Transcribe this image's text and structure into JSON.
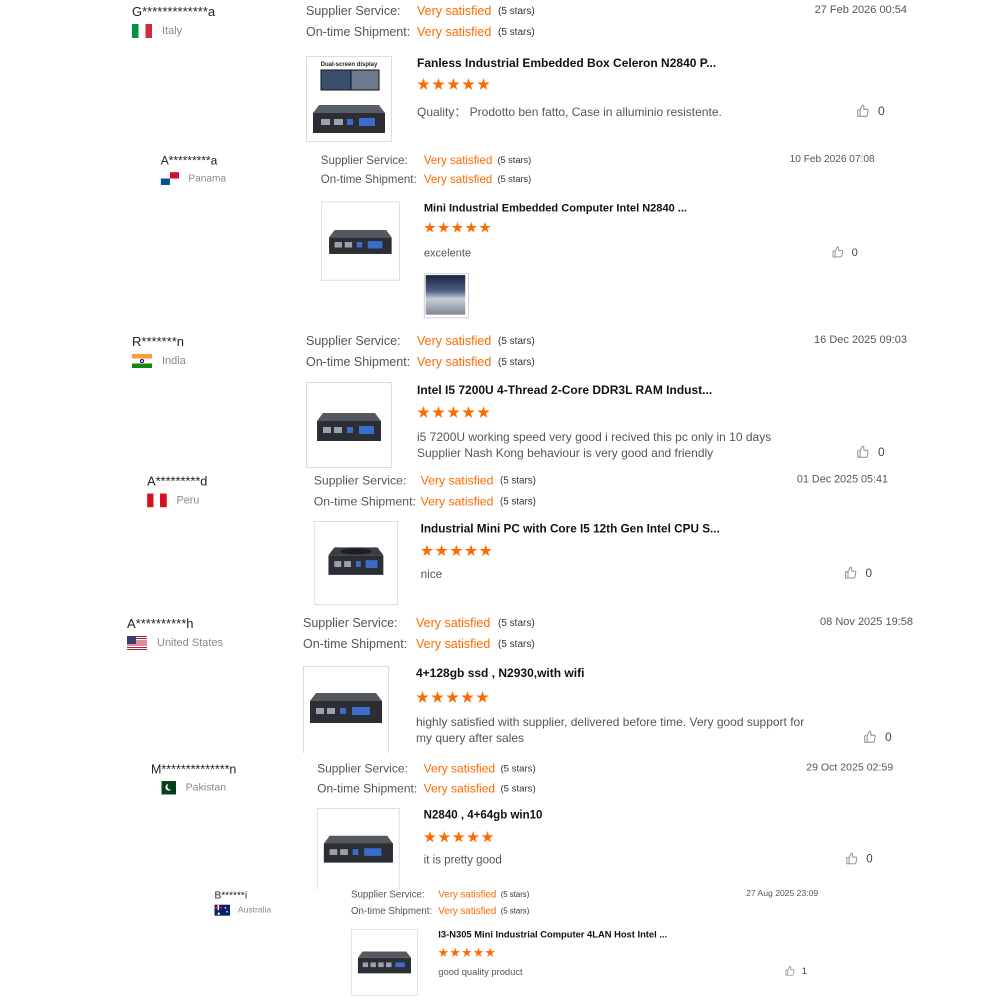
{
  "labels": {
    "supplier_service": "Supplier Service:",
    "shipment": "On-time Shipment:"
  },
  "reviews": [
    {
      "buyer": "G*************a",
      "country": "Italy",
      "supplier_value": "Very satisfied",
      "supplier_stars": "(5 stars)",
      "shipment_value": "Very satisfied",
      "shipment_stars": "(5 stars)",
      "date": "27 Feb 2026 00:54",
      "product_title": "Fanless Industrial Embedded Box Celeron N2840 P...",
      "thumbnail_caption": "Dual-screen display",
      "rating": 5,
      "comment": "Quality：  Prodotto ben fatto, Case in alluminio resistente.",
      "likes": "0"
    },
    {
      "buyer": "A*********a",
      "country": "Panama",
      "supplier_value": "Very satisfied",
      "supplier_stars": "(5 stars)",
      "shipment_value": "Very satisfied",
      "shipment_stars": "(5 stars)",
      "date": "10 Feb 2026 07:08",
      "product_title": "Mini Industrial Embedded Computer Intel N2840 ...",
      "rating": 5,
      "comment": "excelente",
      "likes": "0"
    },
    {
      "buyer": "R*******n",
      "country": "India",
      "supplier_value": "Very satisfied",
      "supplier_stars": "(5 stars)",
      "shipment_value": "Very satisfied",
      "shipment_stars": "(5 stars)",
      "date": "16 Dec 2025 09:03",
      "product_title": "Intel I5 7200U 4-Thread 2-Core DDR3L RAM Indust...",
      "rating": 5,
      "comment": "i5 7200U working speed very good i recived this pc only in 10 days Supplier Nash Kong behaviour is very good and friendly",
      "likes": "0"
    },
    {
      "buyer": "A*********d",
      "country": "Peru",
      "supplier_value": "Very satisfied",
      "supplier_stars": "(5 stars)",
      "shipment_value": "Very satisfied",
      "shipment_stars": "(5 stars)",
      "date": "01 Dec 2025 05:41",
      "product_title": "Industrial Mini PC with Core I5 12th Gen Intel CPU S...",
      "rating": 5,
      "comment": "nice",
      "likes": "0"
    },
    {
      "buyer": "A**********h",
      "country": "United States",
      "supplier_value": "Very satisfied",
      "supplier_stars": "(5 stars)",
      "shipment_value": "Very satisfied",
      "shipment_stars": "(5 stars)",
      "date": "08 Nov 2025 19:58",
      "product_title": "4+128gb ssd , N2930,with wifi",
      "rating": 5,
      "comment": "highly satisfied with supplier, delivered before time.  Very good support for my query after sales",
      "likes": "0"
    },
    {
      "buyer": "M**************n",
      "country": "Pakistan",
      "supplier_value": "Very satisfied",
      "supplier_stars": "(5 stars)",
      "shipment_value": "Very satisfied",
      "shipment_stars": "(5 stars)",
      "date": "29 Oct 2025 02:59",
      "product_title": "N2840 , 4+64gb win10",
      "rating": 5,
      "comment": "it is pretty good",
      "likes": "0"
    },
    {
      "buyer": "B******i",
      "country": "Australia",
      "supplier_value": "Very satisfied",
      "supplier_stars": "(5 stars)",
      "shipment_value": "Very satisfied",
      "shipment_stars": "(5 stars)",
      "date": "27 Aug 2025 23:09",
      "product_title": "I3-N305 Mini Industrial Computer 4LAN Host Intel ...",
      "rating": 5,
      "comment": "good quality product",
      "likes": "1"
    }
  ],
  "icons": {
    "like": "thumbs-up-icon",
    "star": "star-icon",
    "flag": "country-flag-icon"
  },
  "colors": {
    "accent": "#ff6a00",
    "label": "#555555",
    "title": "#111111",
    "muted": "#888888"
  }
}
